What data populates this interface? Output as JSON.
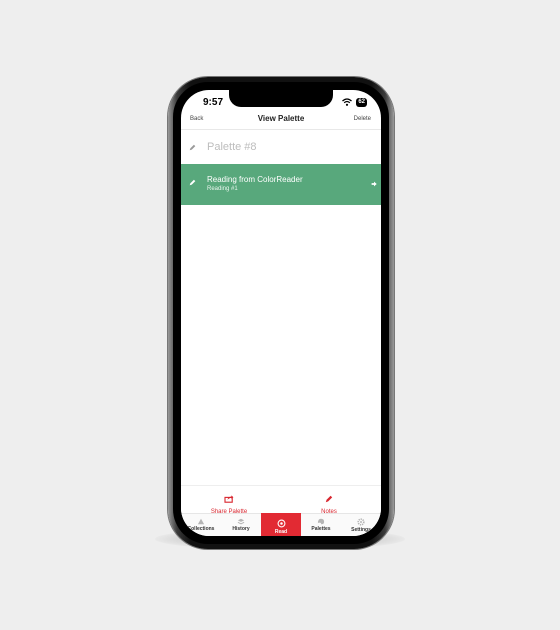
{
  "status": {
    "time": "9:57",
    "battery": "62"
  },
  "navbar": {
    "back": "Back",
    "title": "View Palette",
    "delete": "Delete"
  },
  "palette": {
    "name": "Palette #8"
  },
  "readings": [
    {
      "title": "Reading from ColorReader",
      "subtitle": "Reading #1",
      "color": "#58a87c"
    }
  ],
  "actions": {
    "share": "Share Palette",
    "notes": "Notes"
  },
  "tabs": [
    {
      "label": "Collections",
      "icon": "collections-icon"
    },
    {
      "label": "History",
      "icon": "history-icon"
    },
    {
      "label": "Read",
      "icon": "read-icon",
      "active": true
    },
    {
      "label": "Palettes",
      "icon": "palettes-icon"
    },
    {
      "label": "Settings",
      "icon": "settings-icon"
    }
  ],
  "colors": {
    "accent": "#e22a33",
    "reading": "#58a87c"
  }
}
